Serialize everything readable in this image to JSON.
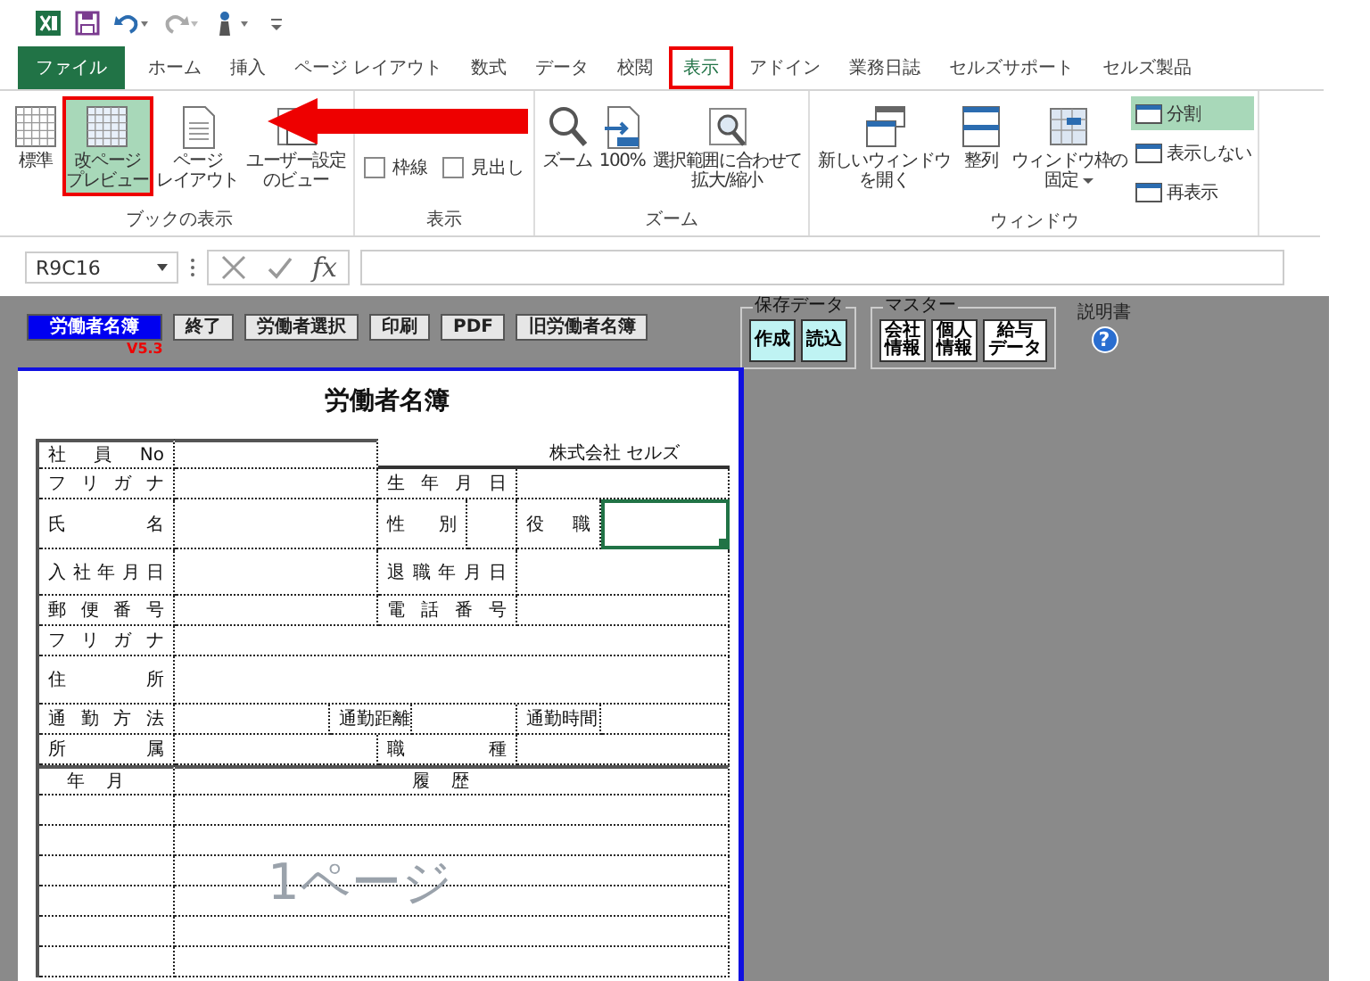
{
  "ribbon_tabs": [
    {
      "label": "ファイル",
      "kind": "file",
      "selected": false
    },
    {
      "label": "ホーム",
      "kind": "tab",
      "selected": false
    },
    {
      "label": "挿入",
      "kind": "tab",
      "selected": false
    },
    {
      "label": "ページ レイアウト",
      "kind": "tab",
      "selected": false
    },
    {
      "label": "数式",
      "kind": "tab",
      "selected": false
    },
    {
      "label": "データ",
      "kind": "tab",
      "selected": false
    },
    {
      "label": "校閲",
      "kind": "tab",
      "selected": false
    },
    {
      "label": "表示",
      "kind": "tab",
      "selected": true
    },
    {
      "label": "アドイン",
      "kind": "tab",
      "selected": false
    },
    {
      "label": "業務日誌",
      "kind": "tab",
      "selected": false
    },
    {
      "label": "セルズサポート",
      "kind": "tab",
      "selected": false
    },
    {
      "label": "セルズ製品",
      "kind": "tab",
      "selected": false
    }
  ],
  "ribbon_groups": [
    {
      "label": "ブックの表示",
      "items": [
        {
          "kind": "large",
          "label": [
            "標準"
          ],
          "selected": false
        },
        {
          "kind": "large",
          "label": [
            "改ページ",
            "プレビュー"
          ],
          "selected": true
        },
        {
          "kind": "large",
          "label": [
            "ページ",
            "レイアウト"
          ],
          "selected": false
        },
        {
          "kind": "large",
          "label": [
            "ユーザー設定",
            "のビュー"
          ],
          "selected": false
        }
      ]
    },
    {
      "label": "表示",
      "items": [
        {
          "kind": "check",
          "label": "枠線",
          "checked": false
        },
        {
          "kind": "check",
          "label": "見出し",
          "checked": false
        }
      ]
    },
    {
      "label": "ズーム",
      "items": [
        {
          "kind": "large",
          "label": [
            "ズーム"
          ],
          "selected": false
        },
        {
          "kind": "large",
          "label": [
            "100%"
          ],
          "selected": false
        },
        {
          "kind": "large",
          "label": [
            "選択範囲に合わせて",
            "拡大/縮小"
          ],
          "selected": false
        }
      ]
    },
    {
      "label": "ウィンドウ",
      "items": [
        {
          "kind": "large",
          "label": [
            "新しいウィンドウ",
            "を開く"
          ],
          "selected": false
        },
        {
          "kind": "large",
          "label": [
            "整列"
          ],
          "selected": false
        },
        {
          "kind": "large",
          "label": [
            "ウィンドウ枠の",
            "固定"
          ],
          "selected": false,
          "dropdown": true
        },
        {
          "kind": "small",
          "label": "分割",
          "selected": true
        },
        {
          "kind": "small",
          "label": "表示しない",
          "selected": false
        },
        {
          "kind": "small",
          "label": "再表示",
          "selected": false
        }
      ]
    }
  ],
  "formula_bar": {
    "name_box": "R9C16",
    "function_label": "fx"
  },
  "sheet_toolbar": {
    "buttons": [
      {
        "label": "労働者名簿",
        "kind": "primary"
      },
      {
        "label": "終了",
        "kind": "normal"
      },
      {
        "label": "労働者選択",
        "kind": "normal"
      },
      {
        "label": "印刷",
        "kind": "normal"
      },
      {
        "label": "PDF",
        "kind": "normal"
      },
      {
        "label": "旧労働者名簿",
        "kind": "normal"
      }
    ],
    "version": "V5.3",
    "groups": [
      {
        "label": "保存データ",
        "kind": "cyan",
        "buttons": [
          [
            "作成"
          ],
          [
            "読込"
          ]
        ]
      },
      {
        "label": "マスター",
        "kind": "white",
        "buttons": [
          [
            "会社",
            "情報"
          ],
          [
            "個人",
            "情報"
          ],
          [
            "給与",
            "データ"
          ]
        ]
      }
    ],
    "help": {
      "label": "説明書",
      "icon": "?"
    }
  },
  "page": {
    "title": "労働者名簿",
    "page_label": "1ページ",
    "rows": [
      {
        "cells": [
          {
            "kind": "label",
            "text": "社員No",
            "selected": false
          },
          {
            "kind": "value",
            "selected": false
          },
          {
            "kind": "blank",
            "selected": false
          },
          {
            "kind": "note",
            "text": "株式会社 セルズ",
            "selected": false
          }
        ]
      },
      {
        "cells": [
          {
            "kind": "label",
            "text": "フリガナ",
            "selected": false
          },
          {
            "kind": "value",
            "selected": false
          },
          {
            "kind": "label",
            "text": "生年月日",
            "selected": false
          },
          {
            "kind": "value",
            "selected": false
          }
        ]
      },
      {
        "cells": [
          {
            "kind": "label",
            "text": "氏名",
            "selected": false
          },
          {
            "kind": "value",
            "selected": false
          },
          {
            "kind": "label",
            "text": "性別",
            "selected": false
          },
          {
            "kind": "value",
            "selected": false
          },
          {
            "kind": "label",
            "text": "役職",
            "selected": false
          },
          {
            "kind": "value",
            "selected": true
          }
        ]
      },
      {
        "cells": [
          {
            "kind": "label",
            "text": "入社年月日",
            "selected": false
          },
          {
            "kind": "value",
            "selected": false
          },
          {
            "kind": "label",
            "text": "退職年月日",
            "selected": false
          },
          {
            "kind": "value",
            "selected": false
          }
        ]
      },
      {
        "cells": [
          {
            "kind": "label",
            "text": "郵便番号",
            "selected": false
          },
          {
            "kind": "value",
            "selected": false
          },
          {
            "kind": "label",
            "text": "電話番号",
            "selected": false
          },
          {
            "kind": "value",
            "selected": false
          }
        ]
      },
      {
        "cells": [
          {
            "kind": "label",
            "text": "フリガナ",
            "selected": false
          },
          {
            "kind": "value",
            "selected": false
          }
        ]
      },
      {
        "cells": [
          {
            "kind": "label",
            "text": "住所",
            "selected": false
          },
          {
            "kind": "value",
            "selected": false
          }
        ]
      },
      {
        "cells": [
          {
            "kind": "label",
            "text": "通勤方法",
            "selected": false
          },
          {
            "kind": "value",
            "selected": false
          },
          {
            "kind": "label",
            "text": "通勤距離",
            "selected": false
          },
          {
            "kind": "value",
            "selected": false
          },
          {
            "kind": "label",
            "text": "通勤時間",
            "selected": false
          },
          {
            "kind": "value",
            "selected": false
          }
        ]
      },
      {
        "cells": [
          {
            "kind": "label",
            "text": "所属",
            "selected": false
          },
          {
            "kind": "value",
            "selected": false
          },
          {
            "kind": "label",
            "text": "職種",
            "selected": false
          },
          {
            "kind": "value",
            "selected": false
          }
        ]
      },
      {
        "cells": [
          {
            "kind": "heading",
            "text": "年月",
            "selected": false
          },
          {
            "kind": "heading",
            "text": "履歴",
            "selected": false
          }
        ]
      },
      {
        "cells": [
          {
            "kind": "value",
            "selected": false
          },
          {
            "kind": "value",
            "selected": false
          }
        ]
      },
      {
        "cells": [
          {
            "kind": "value",
            "selected": false
          },
          {
            "kind": "value",
            "selected": false
          }
        ]
      },
      {
        "cells": [
          {
            "kind": "value",
            "selected": false
          },
          {
            "kind": "value",
            "selected": false
          }
        ]
      },
      {
        "cells": [
          {
            "kind": "value",
            "selected": false
          },
          {
            "kind": "value",
            "selected": false
          }
        ]
      },
      {
        "cells": [
          {
            "kind": "value",
            "selected": false
          },
          {
            "kind": "value",
            "selected": false
          }
        ]
      },
      {
        "cells": [
          {
            "kind": "value",
            "selected": false
          },
          {
            "kind": "value",
            "selected": false
          }
        ]
      }
    ]
  }
}
